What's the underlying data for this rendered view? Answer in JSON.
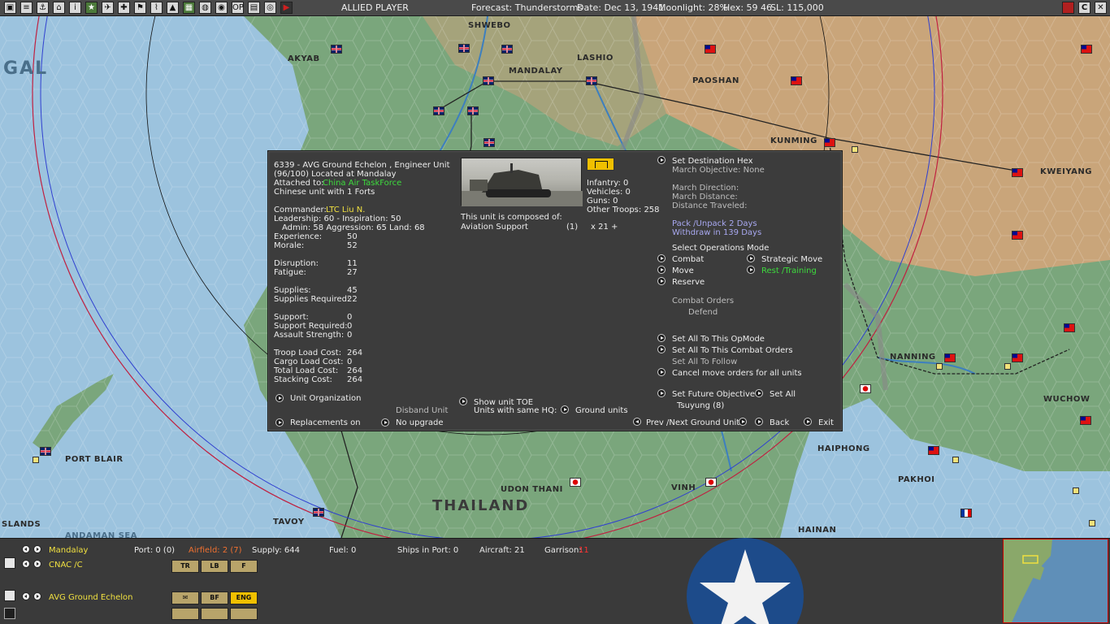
{
  "topbar": {
    "side": "ALLIED PLAYER",
    "forecast": "Forecast: Thunderstorms",
    "date": "Date: Dec 13, 1941",
    "moonlight": "Moonlight: 28%",
    "hex": "Hex: 59  46",
    "sl": "SL: 115,000",
    "icons": [
      "map-icon",
      "list-icon",
      "ship-icon",
      "carrier-icon",
      "info-icon",
      "star-icon",
      "plane-icon",
      "cross-icon",
      "flag-icon",
      "chart-icon",
      "terrain-icon",
      "factory-icon",
      "globe-icon",
      "globe2-icon",
      "op-icon",
      "report-icon",
      "disc-icon",
      "play-icon"
    ],
    "right_icons": [
      "red-flag-icon",
      "c-icon",
      "settings-icon",
      "close-icon"
    ],
    "right_labels": [
      "",
      "C",
      "",
      ""
    ],
    "op_label": "OP"
  },
  "map": {
    "cities": [
      {
        "name": "SHWEBO"
      },
      {
        "name": "AKYAB"
      },
      {
        "name": "LASHIO"
      },
      {
        "name": "MANDALAY"
      },
      {
        "name": "PAOSHAN"
      },
      {
        "name": "KUNMING"
      },
      {
        "name": "KWEIYANG"
      },
      {
        "name": "NANNING"
      },
      {
        "name": "WUCHOW"
      },
      {
        "name": "HAIPHONG"
      },
      {
        "name": "PAKHOI"
      },
      {
        "name": "HAINAN"
      },
      {
        "name": "UDON THANI"
      },
      {
        "name": "VINH"
      },
      {
        "name": "TAVOY"
      },
      {
        "name": "PORT BLAIR"
      },
      {
        "name": "SLANDS"
      },
      {
        "name": "ANDAMAN SEA"
      }
    ],
    "regions": [
      {
        "name": "THAILAND"
      },
      {
        "name": "GAL"
      }
    ]
  },
  "panel": {
    "header1": "6339 - AVG Ground Echelon , Engineer Unit",
    "header2": "(96/100) Located at  Mandalay",
    "attached_label": "Attached to:",
    "attached_value": "China Air TaskForce",
    "forts": "Chinese unit with 1 Forts",
    "commander_label": "Commander:",
    "commander_value": "LTC Liu N.",
    "leadership": "Leadership: 60 - Inspiration: 50",
    "admin": "Admin: 58  Aggression: 65 Land: 68",
    "stats": [
      {
        "label": "Experience:",
        "value": "50"
      },
      {
        "label": "Morale:",
        "value": "52"
      },
      {
        "label": "Disruption:",
        "value": "11"
      },
      {
        "label": "Fatigue:",
        "value": "27"
      },
      {
        "label": "Supplies:",
        "value": "45"
      },
      {
        "label": "Supplies Required:",
        "value": "22"
      },
      {
        "label": "Support:",
        "value": "0"
      },
      {
        "label": "Support Required:",
        "value": "0"
      },
      {
        "label": "Assault Strength:",
        "value": "0"
      },
      {
        "label": "Troop Load Cost:",
        "value": "264"
      },
      {
        "label": "Cargo Load Cost:",
        "value": "0"
      },
      {
        "label": "Total Load Cost:",
        "value": "264"
      },
      {
        "label": "Stacking Cost:",
        "value": "264"
      }
    ],
    "unit_org": "Unit Organization",
    "disband": "Disband Unit",
    "replacements": "Replacements on",
    "no_upgrade": "No upgrade",
    "show_toe": "Show unit TOE",
    "units_same_hq": "Units with same HQ:",
    "ground_units": "Ground units",
    "composition": [
      {
        "label": "Infantry: 0"
      },
      {
        "label": "Vehicles: 0"
      },
      {
        "label": "Guns: 0"
      },
      {
        "label": "Other Troops: 258"
      }
    ],
    "composed_of": "This unit is composed of:",
    "component_name": "Aviation Support",
    "component_count": "(1)",
    "component_mult": "x 21 +",
    "set_destination": "Set Destination Hex",
    "march_objective": "March Objective: None",
    "march_direction": "March Direction:",
    "march_distance": "March Distance:",
    "distance_traveled": "Distance Traveled:",
    "pack_unpack": "Pack /Unpack 2 Days",
    "withdraw": "Withdraw in 139 Days",
    "select_ops": "Select Operations Mode",
    "modes": {
      "combat": "Combat",
      "move": "Move",
      "reserve": "Reserve",
      "strategic": "Strategic Move",
      "rest": "Rest /Training"
    },
    "combat_orders": "Combat Orders",
    "defend": "Defend",
    "set_all_opmode": "Set All To This OpMode",
    "set_all_combat": "Set All To This Combat Orders",
    "set_all_follow": "Set All To Follow",
    "cancel_move": "Cancel move orders for all units",
    "set_future": "Set Future Objective",
    "set_all": "Set All",
    "tsuyung": "Tsuyung (8)",
    "prev_next": "Prev /Next Ground Unit",
    "back": "Back",
    "exit": "Exit"
  },
  "bottom": {
    "location": "Mandalay",
    "port": "Port: 0 (0)",
    "airfield": "Airfield: 2 (7)",
    "supply": "Supply: 644",
    "fuel": "Fuel: 0",
    "ships_in_port": "Ships in Port: 0",
    "aircraft": "Aircraft: 21",
    "garrison_label": "Garrison:",
    "garrison_value": "11",
    "air_hq": "CNAC /C",
    "unit_name": "AVG Ground Echelon",
    "air_buttons": [
      {
        "label": "TR"
      },
      {
        "label": "LB"
      },
      {
        "label": "F"
      }
    ],
    "ground_buttons": [
      {
        "label": "✉"
      },
      {
        "label": "BF"
      },
      {
        "label": "ENG"
      }
    ]
  },
  "colors": {
    "highlight_yellow": "#f0e040",
    "green": "#3ddc3d",
    "lavender": "#a8a8f0",
    "garrison_red": "#ff3030",
    "badge": "#f0c000"
  }
}
